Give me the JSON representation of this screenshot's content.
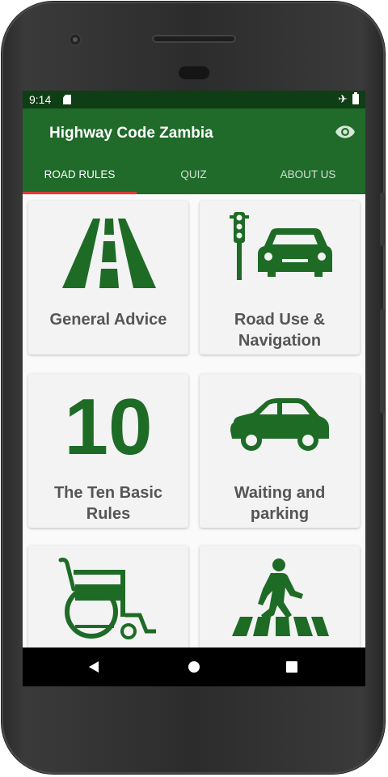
{
  "status": {
    "time": "9:14"
  },
  "appbar": {
    "title": "Highway Code Zambia"
  },
  "tabs": [
    {
      "label": "ROAD RULES"
    },
    {
      "label": "QUIZ"
    },
    {
      "label": "ABOUT US"
    }
  ],
  "cards": [
    {
      "label": "General Advice",
      "icon": "road-icon"
    },
    {
      "label": "Road Use &\nNavigation",
      "icon": "traffic-light-car-icon"
    },
    {
      "label": "The Ten Basic\nRules",
      "icon": "number-10-icon",
      "icon_text": "10"
    },
    {
      "label": "Waiting and\nparking",
      "icon": "car-icon"
    },
    {
      "label": "",
      "icon": "wheelchair-icon"
    },
    {
      "label": "",
      "icon": "pedestrian-crossing-icon"
    }
  ],
  "colors": {
    "primary": "#206a2a",
    "status": "#0f3d14",
    "accent": "#e53935",
    "icon": "#1e6b26",
    "label": "#555555",
    "card": "#f3f3f3"
  }
}
